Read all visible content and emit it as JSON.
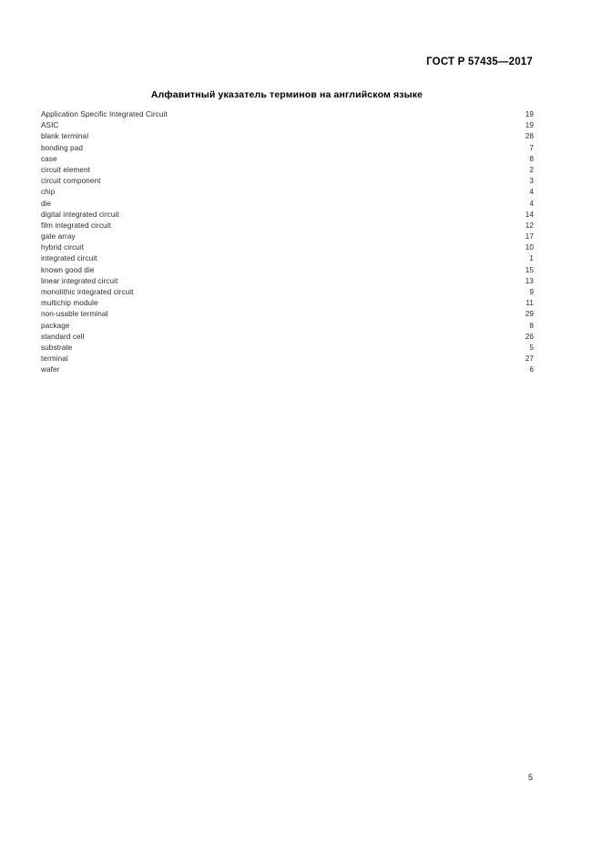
{
  "header": {
    "standard_reference": "ГОСТ Р 57435—2017"
  },
  "title": "Алфавитный указатель терминов на английском языке",
  "footer": {
    "page_number": "5"
  },
  "index": {
    "entries": [
      {
        "term": "Application Specific Integrated Circuit",
        "page": "19"
      },
      {
        "term": "ASIC",
        "page": "19"
      },
      {
        "term": "blank terminal",
        "page": "28"
      },
      {
        "term": "bonding pad",
        "page": "7"
      },
      {
        "term": "case",
        "page": "8"
      },
      {
        "term": "circuit element",
        "page": "2"
      },
      {
        "term": "circuit component",
        "page": "3"
      },
      {
        "term": "chip",
        "page": "4"
      },
      {
        "term": "die",
        "page": "4"
      },
      {
        "term": "digital integrated circuit",
        "page": "14"
      },
      {
        "term": "film integrated circuit",
        "page": "12"
      },
      {
        "term": "gate array",
        "page": "17"
      },
      {
        "term": "hybrid circuit",
        "page": "10"
      },
      {
        "term": "integrated circuit",
        "page": "1"
      },
      {
        "term": "known good die",
        "page": "15"
      },
      {
        "term": "linear integrated circuit",
        "page": "13"
      },
      {
        "term": "monolithic integrated circuit",
        "page": "9"
      },
      {
        "term": "multichip module",
        "page": "11"
      },
      {
        "term": "non-usable terminal",
        "page": "29"
      },
      {
        "term": "package",
        "page": "8"
      },
      {
        "term": "standard cell",
        "page": "26"
      },
      {
        "term": "substrate",
        "page": "5"
      },
      {
        "term": "terminal",
        "page": "27"
      },
      {
        "term": "wafer",
        "page": "6"
      }
    ]
  }
}
